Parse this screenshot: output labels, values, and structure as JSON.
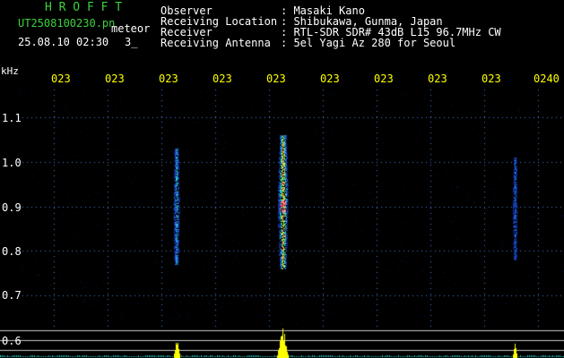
{
  "header": {
    "brand": "H R O F F T",
    "file_name": "UT2508100230.pn",
    "mode": "meteor",
    "datetime": "25.08.10 02:30",
    "count": "3_"
  },
  "info": {
    "labels": [
      "Observer",
      "Receiving Location",
      "Receiver",
      "Receiving Antenna"
    ],
    "values": [
      ": Masaki Kano",
      ": Shibukawa, Gunma, Japan",
      ": RTL-SDR SDR# 43dB L15 96.7MHz CW",
      ": 5el Yagi Az 280 for Seoul"
    ]
  },
  "axis": {
    "unit": "kHz",
    "time_ticks": [
      "023",
      "023",
      "023",
      "023",
      "023",
      "023",
      "023",
      "023",
      "023",
      "0240"
    ],
    "freq_ticks": [
      "1.1",
      "1.0",
      "0.9",
      "0.8",
      "0.7",
      "0.6"
    ]
  },
  "chart_data": {
    "type": "heatmap",
    "ylabel": "kHz",
    "ylim": [
      0.57,
      1.15
    ],
    "events": [
      {
        "time_fraction": 0.29,
        "f_low": 0.77,
        "f_high": 1.03,
        "intensity": 0.5
      },
      {
        "time_fraction": 0.485,
        "f_low": 0.76,
        "f_high": 1.06,
        "intensity": 1.0
      },
      {
        "time_fraction": 0.91,
        "f_low": 0.78,
        "f_high": 1.01,
        "intensity": 0.3
      }
    ]
  },
  "colors": {
    "background": "#000000",
    "header_green": "#3cd23c",
    "text_white": "#ffffff",
    "tick_yellow": "#ffff00",
    "grid_blue": "#4a7fd0",
    "signal_yellow": "#ffff00"
  }
}
